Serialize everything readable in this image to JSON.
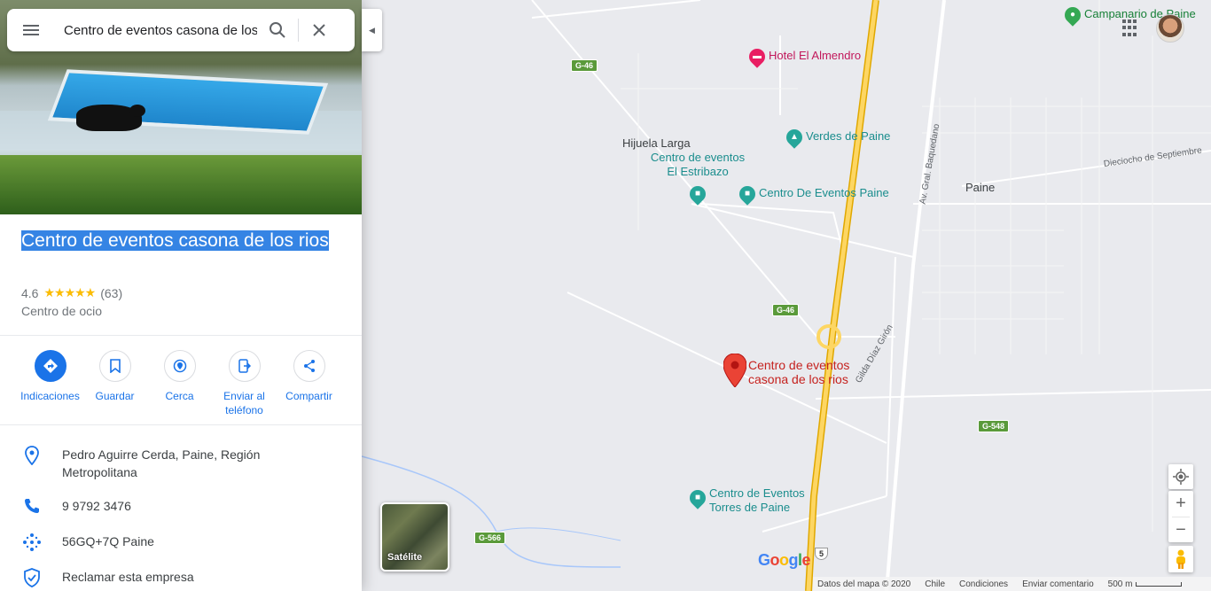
{
  "search": {
    "value": "Centro de eventos casona de los rios"
  },
  "place": {
    "title": "Centro de eventos casona de los rios",
    "rating": "4.6",
    "stars": "★★★★★",
    "review_count": "(63)",
    "category": "Centro de ocio"
  },
  "actions": [
    {
      "label": "Indicaciones",
      "icon": "directions-icon"
    },
    {
      "label": "Guardar",
      "icon": "bookmark-icon"
    },
    {
      "label": "Cerca",
      "icon": "nearby-icon"
    },
    {
      "label": "Enviar al teléfono",
      "icon": "send-to-phone-icon"
    },
    {
      "label": "Compartir",
      "icon": "share-icon"
    }
  ],
  "info": {
    "address": "Pedro Aguirre Cerda, Paine, Región Metropolitana",
    "phone": "9 9792 3476",
    "plus_code": "56GQ+7Q Paine",
    "claim": "Reclamar esta empresa"
  },
  "map": {
    "pois": {
      "hotel": "Hotel El Almendro",
      "verdes": "Verdes de Paine",
      "estribazo": "Centro de eventos El Estribazo",
      "paine_events": "Centro De Eventos Paine",
      "torres": "Centro de Eventos Torres de Paine",
      "campanario": "Campanario de Paine"
    },
    "selected_label": "Centro de eventos casona de los rios",
    "labels": {
      "hijuela": "Hijuela Larga",
      "paine": "Paine"
    },
    "roads": {
      "g46_top": "G-46",
      "g46_mid": "G-46",
      "g548": "G-548",
      "g566": "G-566",
      "route5": "5",
      "baquedano": "Av. Gral. Baquedano",
      "dieciocho": "Dieciocho de Septiembre",
      "gilda": "Gilda Díaz Girón"
    },
    "satellite_label": "Satélite",
    "footer": {
      "data": "Datos del mapa © 2020",
      "country": "Chile",
      "terms": "Condiciones",
      "feedback": "Enviar comentario",
      "scale": "500 m"
    },
    "zoom_in": "+",
    "zoom_out": "−"
  }
}
